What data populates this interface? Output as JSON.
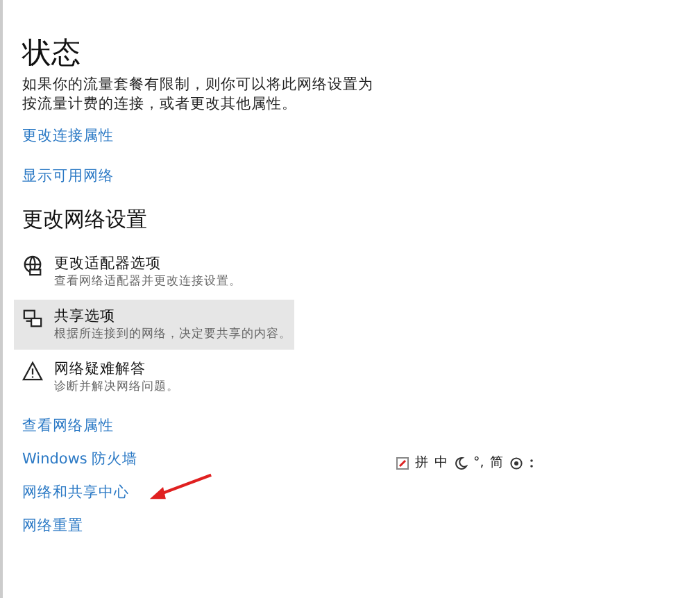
{
  "title": "状态",
  "description": "如果你的流量套餐有限制，则你可以将此网络设置为按流量计费的连接，或者更改其他属性。",
  "top_links": [
    "更改连接属性",
    "显示可用网络"
  ],
  "section_heading": "更改网络设置",
  "options": [
    {
      "kind": "adapter",
      "title": "更改适配器选项",
      "subtitle": "查看网络适配器并更改连接设置。",
      "highlighted": false
    },
    {
      "kind": "sharing",
      "title": "共享选项",
      "subtitle": "根据所连接到的网络，决定要共享的内容。",
      "highlighted": true
    },
    {
      "kind": "troubleshoot",
      "title": "网络疑难解答",
      "subtitle": "诊断并解决网络问题。",
      "highlighted": false
    }
  ],
  "bottom_links": [
    "查看网络属性",
    "Windows 防火墙",
    "网络和共享中心",
    "网络重置"
  ],
  "ime_toolbar": {
    "keys": [
      "拼",
      "中",
      "°,",
      "简"
    ]
  },
  "annotation": {
    "kind": "arrow",
    "color": "#e02020"
  }
}
